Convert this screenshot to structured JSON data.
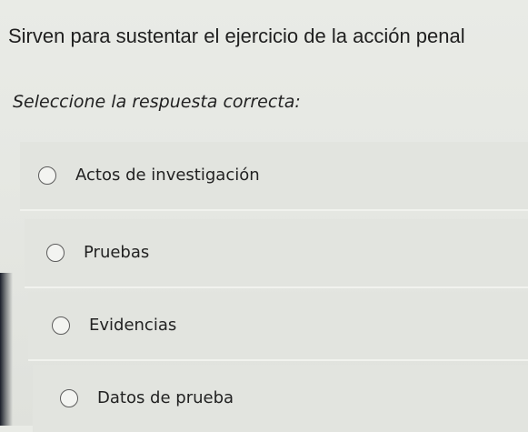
{
  "question": {
    "text": "Sirven para sustentar el ejercicio de la acción penal"
  },
  "instruction": "Seleccione la respuesta correcta:",
  "options": [
    {
      "label": "Actos de investigación",
      "selected": false
    },
    {
      "label": "Pruebas",
      "selected": false
    },
    {
      "label": "Evidencias",
      "selected": false
    },
    {
      "label": "Datos de prueba",
      "selected": false
    }
  ]
}
